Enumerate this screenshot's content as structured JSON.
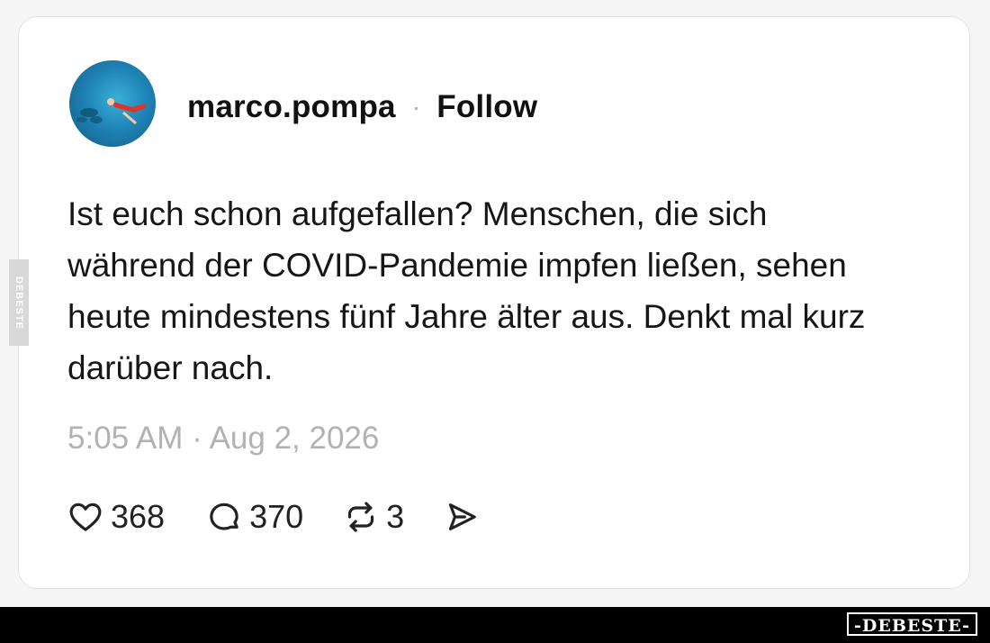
{
  "post": {
    "username": "marco.pompa",
    "separator": "·",
    "follow_label": "Follow",
    "text": "Ist euch schon aufgefallen? Menschen, die sich während der COVID-Pandemie impfen ließen, sehen heute mindestens fünf Jahre älter aus. Denkt mal kurz darüber nach.",
    "timestamp": "5:05 AM · Aug 2, 2026",
    "likes": "368",
    "comments": "370",
    "reposts": "3"
  },
  "watermark": {
    "side": "DEBESTE",
    "bottom": "-DEBESTE-"
  },
  "icons": {
    "like": "heart-icon",
    "comment": "comment-bubble-icon",
    "repost": "repost-icon",
    "share": "send-icon"
  },
  "colors": {
    "text": "#161616",
    "timestamp": "#b2b2b2",
    "card_border": "#e2e2e2",
    "bottom_bar": "#000000"
  }
}
